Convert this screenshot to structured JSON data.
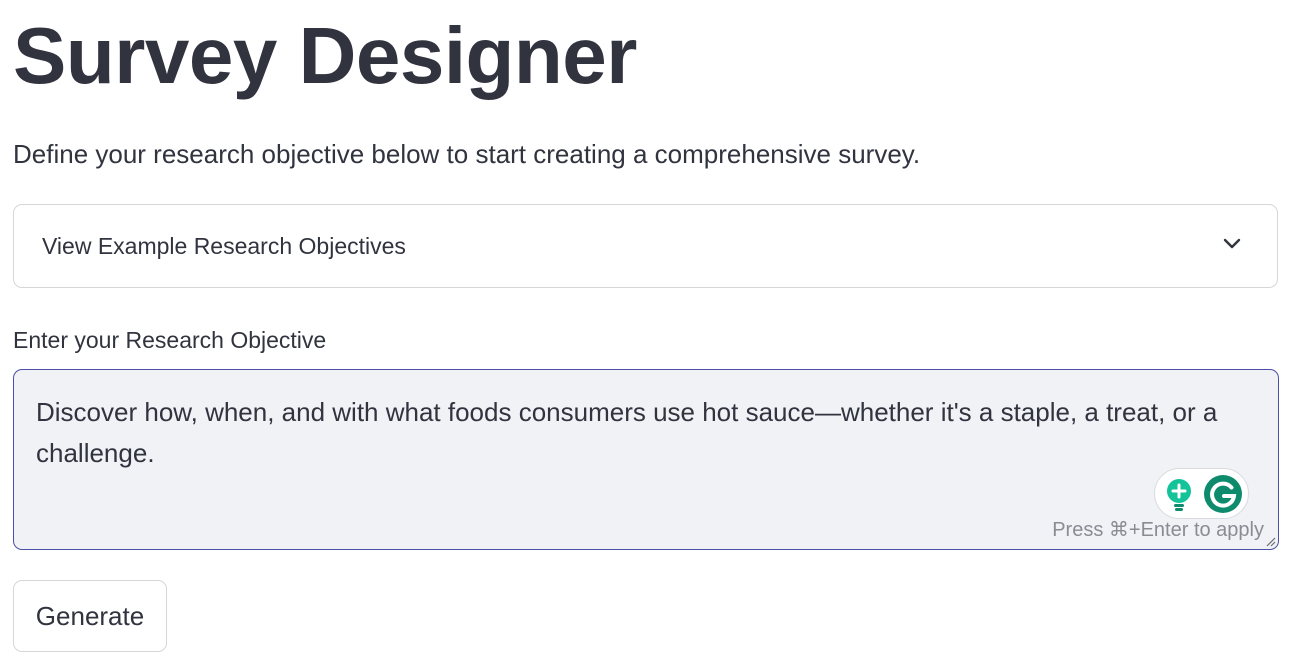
{
  "page": {
    "title": "Survey Designer",
    "subtitle": "Define your research objective below to start creating a comprehensive survey."
  },
  "expander": {
    "label": "View Example Research Objectives",
    "icon": "chevron-down-icon",
    "expanded": false
  },
  "objective_field": {
    "label": "Enter your Research Objective",
    "value": "Discover how, when, and with what foods consumers use hot sauce—whether it's a staple, a treat, or a challenge.",
    "hint": "Press ⌘+Enter to apply"
  },
  "grammarly": {
    "icons": [
      "lightbulb-suggestion-icon",
      "grammarly-logo-icon"
    ],
    "accent_color": "#15c39a",
    "brand_color": "#0e8a6c"
  },
  "actions": {
    "generate_label": "Generate"
  },
  "colors": {
    "text": "#31333f",
    "field_background": "#f0f2f6",
    "field_focus_border": "#4b4fa8",
    "border": "#d6d6d9",
    "hint": "#8a8c94"
  }
}
